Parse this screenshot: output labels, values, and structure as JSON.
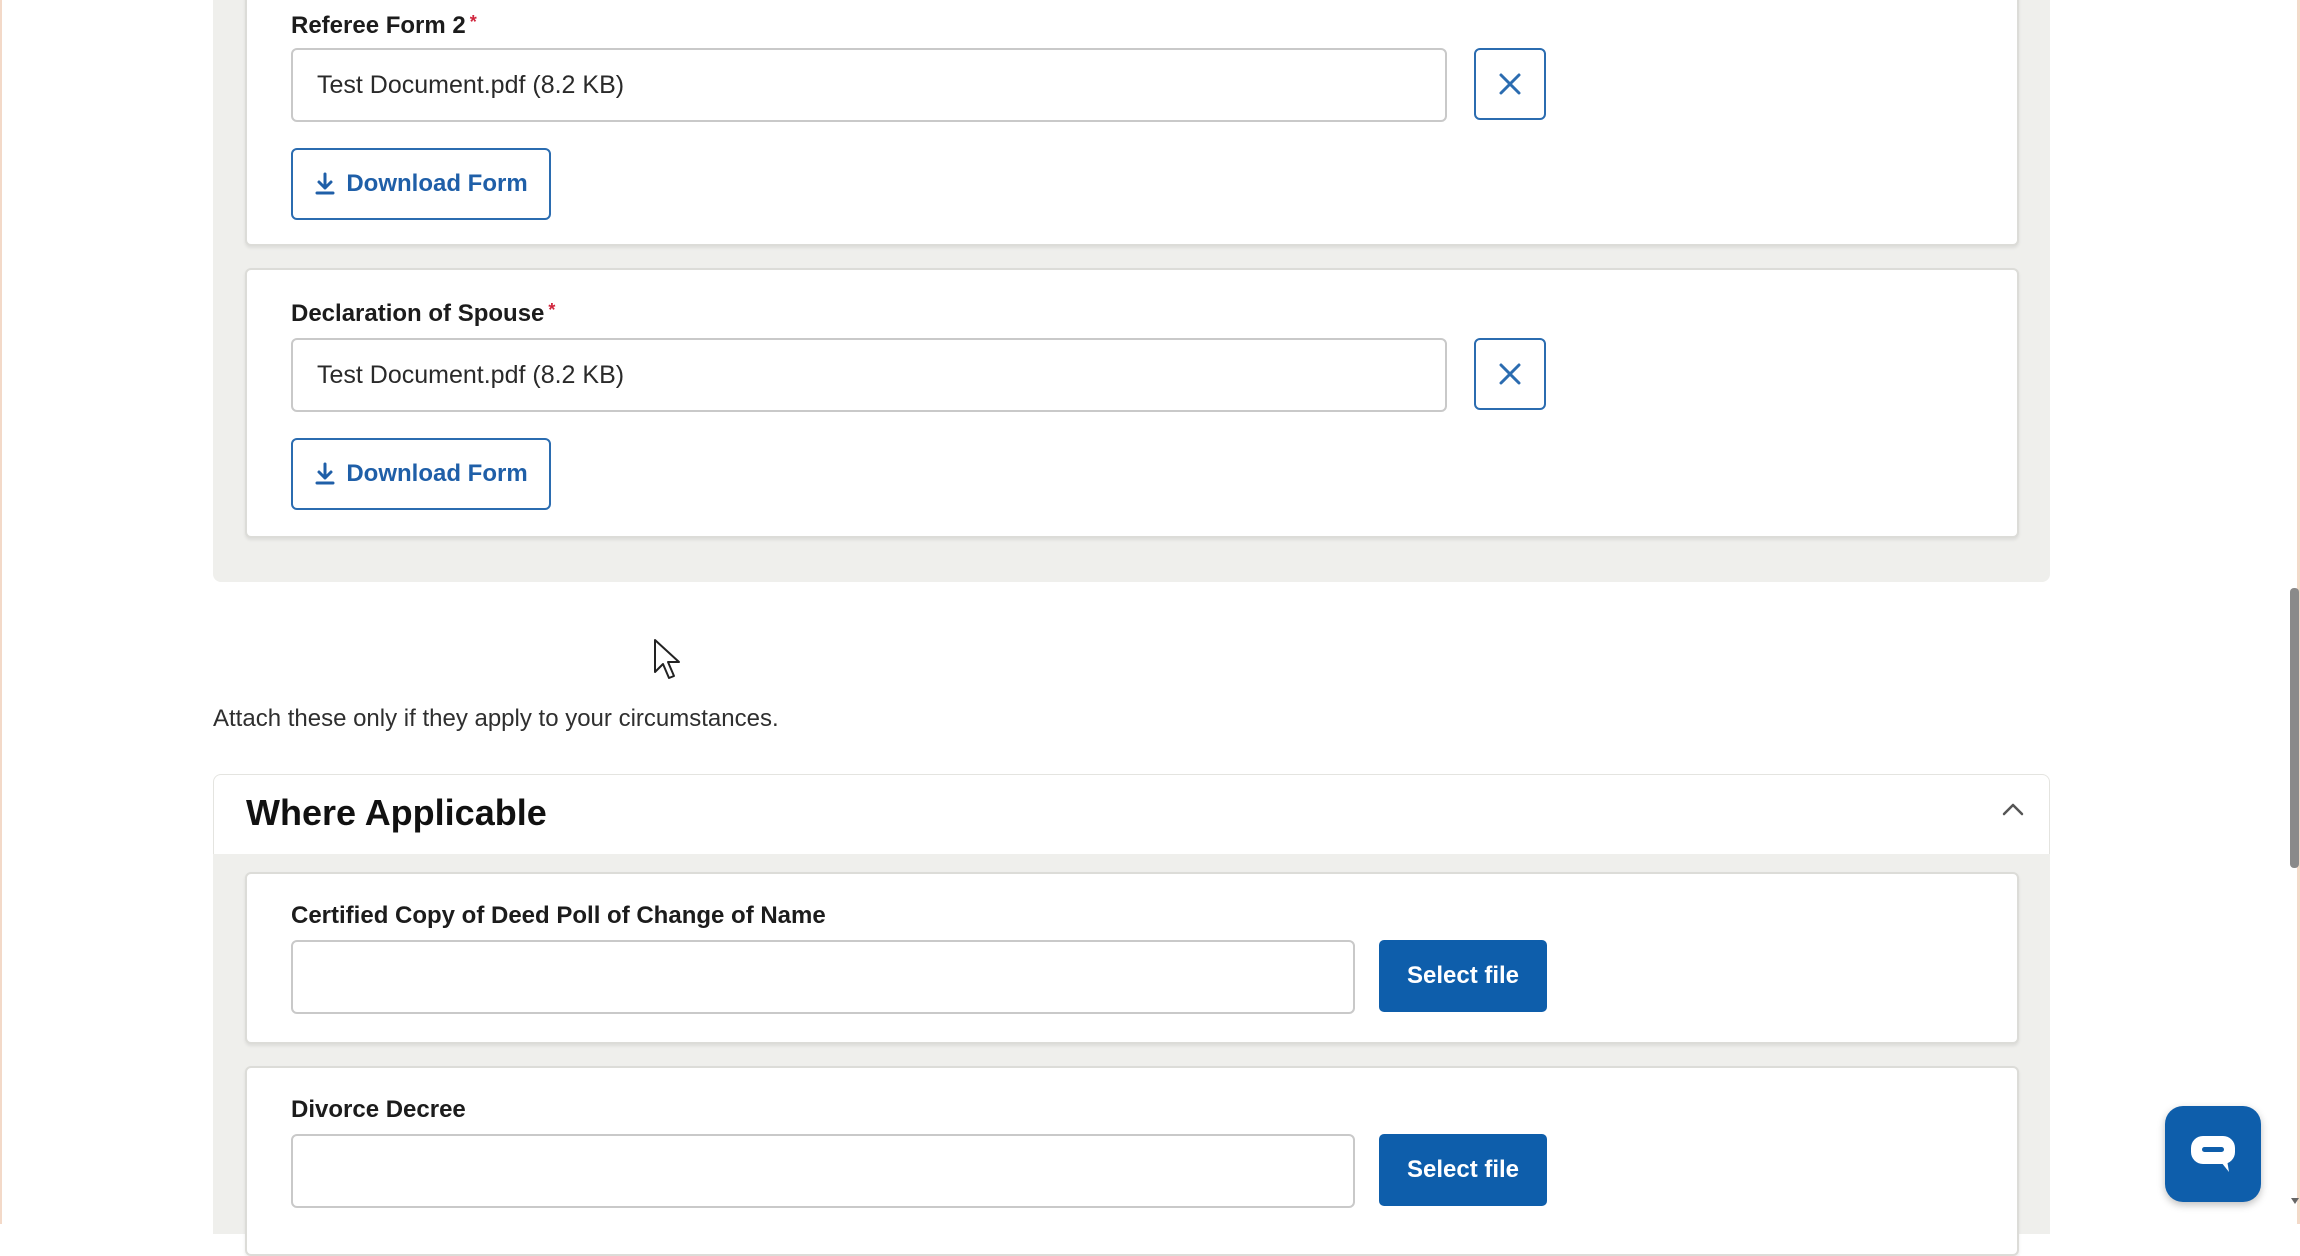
{
  "documents": [
    {
      "label": "Referee Form 2",
      "required_mark": "*",
      "file_value": "Test Document.pdf (8.2 KB)",
      "download_label": "Download Form"
    },
    {
      "label": "Declaration of Spouse",
      "required_mark": "*",
      "file_value": "Test Document.pdf (8.2 KB)",
      "download_label": "Download Form"
    }
  ],
  "helper_text": "Attach these only if they apply to your circumstances.",
  "where_applicable": {
    "title": "Where Applicable",
    "items": [
      {
        "label": "Certified Copy of Deed Poll of Change of Name",
        "file_value": "",
        "select_label": "Select file"
      },
      {
        "label": "Divorce Decree",
        "file_value": "",
        "select_label": "Select file"
      }
    ]
  },
  "icons": {
    "clear": "close-icon",
    "download": "download-icon",
    "collapse": "chevron-up-icon",
    "chat": "chat-bubble-icon"
  },
  "colors": {
    "primary": "#0e5eab",
    "outline": "#2b6cb0",
    "required": "#d0243c",
    "panel": "#efefec"
  }
}
